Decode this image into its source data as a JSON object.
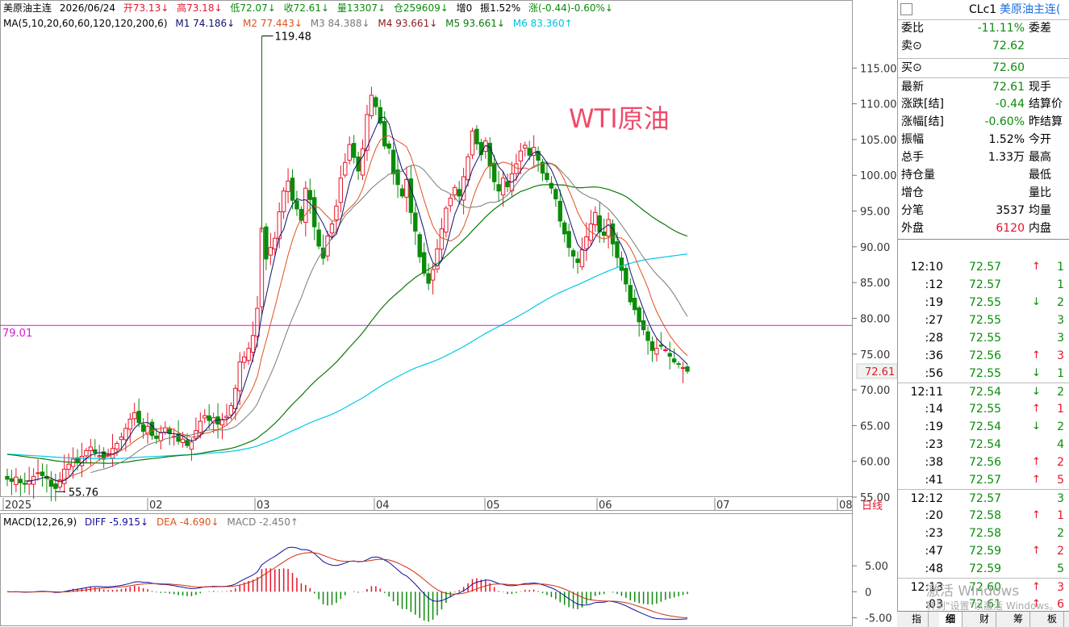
{
  "header": {
    "name": "美原油主连",
    "date": "2026/06/24",
    "open": "开73.13↓",
    "high": "高73.18↓",
    "low": "低72.07↓",
    "close": "收72.61↓",
    "volume": "量13307↓",
    "oi": "仓259609↓",
    "oi_change": "增0",
    "amplitude": "振1.52%",
    "change": "涨(-0.44)-0.60%↓"
  },
  "ma_line": {
    "params": "MA(5,10,20,60,60,120,120,200,6)",
    "m1": "M1 74.186↓",
    "m2": "M2 77.443↓",
    "m3": "M3 84.388↓",
    "m4": "M4 93.661↓",
    "m5": "M5 93.661↓",
    "m6": "M6 83.360↑"
  },
  "annotation": "WTI原油",
  "price_labels": {
    "high_marker": "119.48",
    "low_marker": "55.76",
    "hline_value": "79.01",
    "last_price": "72.61"
  },
  "y_axis_ticks": [
    "115.00",
    "110.00",
    "105.00",
    "100.00",
    "95.00",
    "90.00",
    "85.00",
    "80.00",
    "75.00",
    "70.00",
    "65.00",
    "60.00",
    "55.00"
  ],
  "x_axis_labels": [
    "2025",
    "02",
    "03",
    "04",
    "05",
    "06",
    "07",
    "08"
  ],
  "period": "日线",
  "macd_line": {
    "params": "MACD(12,26,9)",
    "diff": "DIFF -5.915↓",
    "dea": "DEA -4.690↓",
    "macd": "MACD -2.450↑"
  },
  "macd_ticks": [
    "5.00",
    "0",
    "-5.00"
  ],
  "panel": {
    "code": "CLc1",
    "name": "美原油主连(",
    "rows": [
      {
        "l": "委比",
        "v": "-11.11%",
        "r": "委差",
        "vc": "green"
      },
      {
        "l": "卖⊙",
        "v": "72.62",
        "r": "",
        "vc": "green"
      },
      {
        "l": "买⊙",
        "v": "72.60",
        "r": "",
        "vc": "green"
      },
      {
        "l": "最新",
        "v": "72.61",
        "r": "现手",
        "vc": "green"
      },
      {
        "l": "涨跌[结]",
        "v": "-0.44",
        "r": "结算价",
        "vc": "green"
      },
      {
        "l": "涨幅[结]",
        "v": "-0.60%",
        "r": "昨结算",
        "vc": "green"
      },
      {
        "l": "振幅",
        "v": "1.52%",
        "r": "今开",
        "vc": "black"
      },
      {
        "l": "总手",
        "v": "1.33万",
        "r": "最高",
        "vc": "black"
      },
      {
        "l": "持仓量",
        "v": "",
        "r": "最低",
        "vc": "black"
      },
      {
        "l": "增仓",
        "v": "",
        "r": "量比",
        "vc": "black"
      },
      {
        "l": "分笔",
        "v": "3537",
        "r": "均量",
        "vc": "black"
      },
      {
        "l": "外盘",
        "v": "6120",
        "r": "内盘",
        "vc": "red"
      }
    ],
    "ticks": [
      {
        "t": "12:10",
        "p": "72.57",
        "a": "↑",
        "q": "1",
        "ac": "red",
        "qc": "green"
      },
      {
        "t": ":12",
        "p": "72.57",
        "a": "",
        "q": "1",
        "ac": "",
        "qc": "green"
      },
      {
        "t": ":19",
        "p": "72.55",
        "a": "↓",
        "q": "2",
        "ac": "green",
        "qc": "green"
      },
      {
        "t": ":27",
        "p": "72.55",
        "a": "",
        "q": "3",
        "ac": "",
        "qc": "green"
      },
      {
        "t": ":28",
        "p": "72.55",
        "a": "",
        "q": "3",
        "ac": "",
        "qc": "green"
      },
      {
        "t": ":36",
        "p": "72.56",
        "a": "↑",
        "q": "3",
        "ac": "red",
        "qc": "red"
      },
      {
        "t": ":56",
        "p": "72.55",
        "a": "↓",
        "q": "1",
        "ac": "green",
        "qc": "green"
      },
      {
        "t": "12:11",
        "p": "72.54",
        "a": "↓",
        "q": "2",
        "ac": "green",
        "qc": "green"
      },
      {
        "t": ":14",
        "p": "72.55",
        "a": "↑",
        "q": "1",
        "ac": "red",
        "qc": "red"
      },
      {
        "t": ":19",
        "p": "72.54",
        "a": "↓",
        "q": "2",
        "ac": "green",
        "qc": "green"
      },
      {
        "t": ":23",
        "p": "72.54",
        "a": "",
        "q": "4",
        "ac": "",
        "qc": "green"
      },
      {
        "t": ":38",
        "p": "72.56",
        "a": "↑",
        "q": "2",
        "ac": "red",
        "qc": "red"
      },
      {
        "t": ":41",
        "p": "72.57",
        "a": "↑",
        "q": "5",
        "ac": "red",
        "qc": "red"
      },
      {
        "t": "12:12",
        "p": "72.57",
        "a": "",
        "q": "3",
        "ac": "",
        "qc": "green"
      },
      {
        "t": ":20",
        "p": "72.58",
        "a": "↑",
        "q": "1",
        "ac": "red",
        "qc": "red"
      },
      {
        "t": ":23",
        "p": "72.58",
        "a": "",
        "q": "2",
        "ac": "",
        "qc": "green"
      },
      {
        "t": ":47",
        "p": "72.59",
        "a": "↑",
        "q": "2",
        "ac": "red",
        "qc": "red"
      },
      {
        "t": ":48",
        "p": "72.59",
        "a": "",
        "q": "5",
        "ac": "",
        "qc": "green"
      },
      {
        "t": "12:13",
        "p": "72.60",
        "a": "↑",
        "q": "3",
        "ac": "red",
        "qc": "red"
      },
      {
        "t": ":03",
        "p": "72.61",
        "a": "↑",
        "q": "6",
        "ac": "red",
        "qc": "red"
      }
    ]
  },
  "tabs": [
    "指",
    "细",
    "财",
    "筹",
    "板"
  ],
  "watermark": "激活 Windows",
  "watermark_sub": "转到\"设置\"以激活 Windows。",
  "colors": {
    "up": "#e8142a",
    "down": "#0a8c0a",
    "hline": "#d020d0",
    "ma5": "#101070",
    "ma10": "#e0501e",
    "ma20": "#7a7a7a",
    "ma60": "#0a7a0a",
    "ma120": "#00c8e8"
  },
  "chart_data": {
    "type": "candlestick",
    "ylim": [
      55,
      120
    ],
    "closes": [
      57.5,
      57.2,
      57.8,
      57.0,
      56.8,
      57.3,
      57.9,
      58.4,
      58.0,
      57.6,
      56.5,
      56.2,
      57.4,
      58.9,
      59.6,
      60.3,
      59.8,
      60.7,
      61.5,
      62.0,
      61.2,
      60.8,
      60.3,
      60.9,
      61.8,
      62.5,
      63.4,
      64.6,
      65.9,
      66.8,
      65.4,
      64.2,
      64.9,
      63.6,
      63.2,
      64.0,
      64.7,
      63.9,
      63.5,
      62.8,
      63.1,
      62.2,
      62.7,
      64.3,
      65.6,
      66.4,
      65.7,
      66.1,
      65.2,
      65.8,
      66.3,
      67.8,
      70.2,
      73.9,
      74.6,
      75.8,
      77.6,
      81.4,
      92.6,
      88.3,
      89.9,
      91.2,
      94.9,
      97.8,
      99.2,
      96.5,
      95.3,
      93.7,
      98.2,
      96.6,
      92.8,
      90.1,
      88.4,
      91.5,
      93.2,
      95.7,
      99.6,
      101.8,
      104.3,
      102.5,
      100.6,
      103.7,
      108.5,
      111.2,
      109.6,
      107.3,
      104.1,
      103.8,
      100.2,
      98.7,
      97.1,
      99.4,
      94.8,
      92.2,
      88.6,
      86.3,
      84.9,
      86.8,
      89.7,
      92.5,
      95.4,
      96.8,
      98.3,
      97.1,
      99.8,
      102.6,
      106.2,
      104.4,
      102.9,
      104.8,
      101.3,
      99.1,
      97.8,
      99.6,
      98.4,
      100.2,
      101.6,
      103.4,
      104.2,
      102.8,
      103.9,
      102.1,
      100.3,
      99.4,
      98.2,
      96.7,
      93.6,
      91.8,
      89.9,
      88.7,
      87.8,
      89.6,
      91.4,
      93.2,
      94.8,
      92.1,
      91.6,
      93.8,
      90.4,
      88.5,
      86.7,
      84.8,
      82.3,
      81.2,
      79.5,
      78.4,
      76.9,
      75.5,
      75.8,
      76.1,
      75.6,
      74.7,
      73.9,
      73.6,
      73.1,
      72.6
    ],
    "series": [
      {
        "values": []
      }
    ],
    "macd_ylim": [
      -6,
      12
    ]
  }
}
